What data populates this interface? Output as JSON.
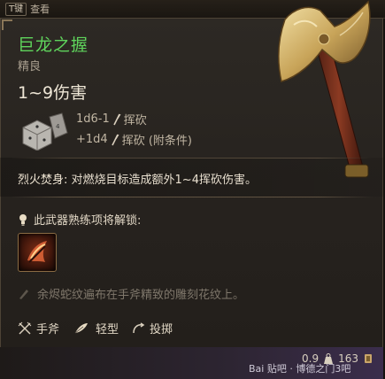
{
  "top_bar": {
    "key": "T键",
    "action": "查看"
  },
  "item": {
    "name": "巨龙之握",
    "rarity": "精良",
    "damage_total": "1~9伤害",
    "damage_lines": [
      {
        "dice": "1d6-1",
        "type": "挥砍"
      },
      {
        "dice": "+1d4",
        "type": "挥砍 (附条件)"
      }
    ],
    "passive": {
      "name": "烈火焚身:",
      "text": "对燃烧目标造成额外1~4挥砍伤害。"
    },
    "proficiency_title": "此武器熟练项将解锁:",
    "flavor": "余烬蛇纹遍布在手斧精致的雕刻花纹上。",
    "properties": [
      {
        "icon": "crossed-blades-icon",
        "label": "手斧"
      },
      {
        "icon": "feather-icon",
        "label": "轻型"
      },
      {
        "icon": "throw-icon",
        "label": "投掷"
      }
    ],
    "weight": "0.9",
    "value": "163"
  },
  "watermark": "Bai 贴吧 · 博德之门3吧",
  "colors": {
    "name_green": "#5fd35c",
    "text_main": "#e1d7c5",
    "text_muted": "#7f776b",
    "gold": "#c9a56a"
  }
}
